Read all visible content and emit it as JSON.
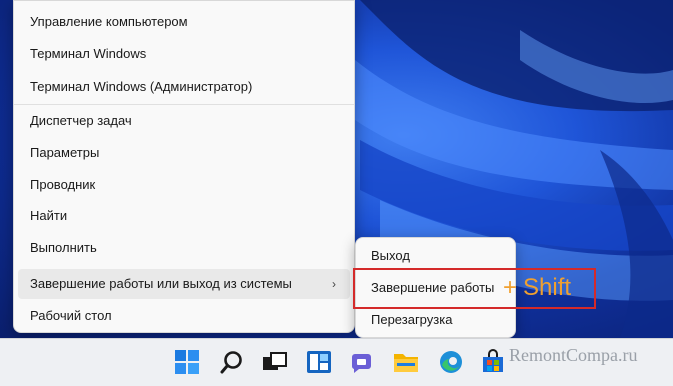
{
  "menu": {
    "items": [
      {
        "label": "Управление компьютером"
      },
      {
        "label": "Терминал Windows"
      },
      {
        "label": "Терминал Windows (Администратор)"
      },
      {
        "label": "Диспетчер задач"
      },
      {
        "label": "Параметры"
      },
      {
        "label": "Проводник"
      },
      {
        "label": "Найти"
      },
      {
        "label": "Выполнить"
      },
      {
        "label": "Завершение работы или выход из системы",
        "arrow": "›"
      },
      {
        "label": "Рабочий стол"
      }
    ]
  },
  "submenu": {
    "items": [
      {
        "label": "Выход"
      },
      {
        "label": "Завершение работы"
      },
      {
        "label": "Перезагрузка"
      }
    ]
  },
  "annotation": {
    "plus": "+",
    "key": "Shift",
    "color": "#f0a030",
    "box_color": "#d42a2a"
  },
  "taskbar": {
    "icons": [
      "start-icon",
      "search-icon",
      "task-view-icon",
      "widgets-icon",
      "chat-icon",
      "file-explorer-icon",
      "edge-icon",
      "store-icon"
    ]
  },
  "watermark": "RemontCompa.ru"
}
